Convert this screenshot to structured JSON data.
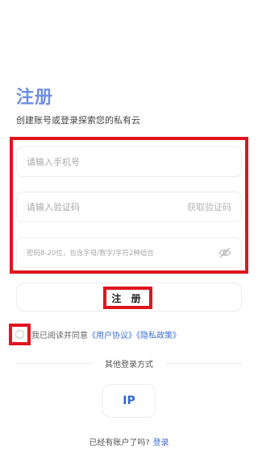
{
  "header": {
    "title": "注册",
    "subtitle": "创建账号或登录探索您的私有云"
  },
  "form": {
    "phone_placeholder": "请输入手机号",
    "code_placeholder": "请输入验证码",
    "get_code_label": "获取验证码",
    "password_placeholder": "密码8-20位，包含字母/数字/字符2种组合",
    "password_toggle_icon": "eye-off-icon"
  },
  "register_label": "注 册",
  "agreement": {
    "prefix": "我已阅读并同意",
    "user_agreement": "《用户协议》",
    "privacy_policy": "《隐私政策》",
    "checked": false
  },
  "other_login": {
    "label": "其他登录方式",
    "ip_label": "IP"
  },
  "footer": {
    "prompt": "已经有账户了吗?",
    "login_link": "登录"
  },
  "colors": {
    "title": "#6f8fe6",
    "highlight": "#e1141e",
    "link": "#3e6fd6"
  }
}
